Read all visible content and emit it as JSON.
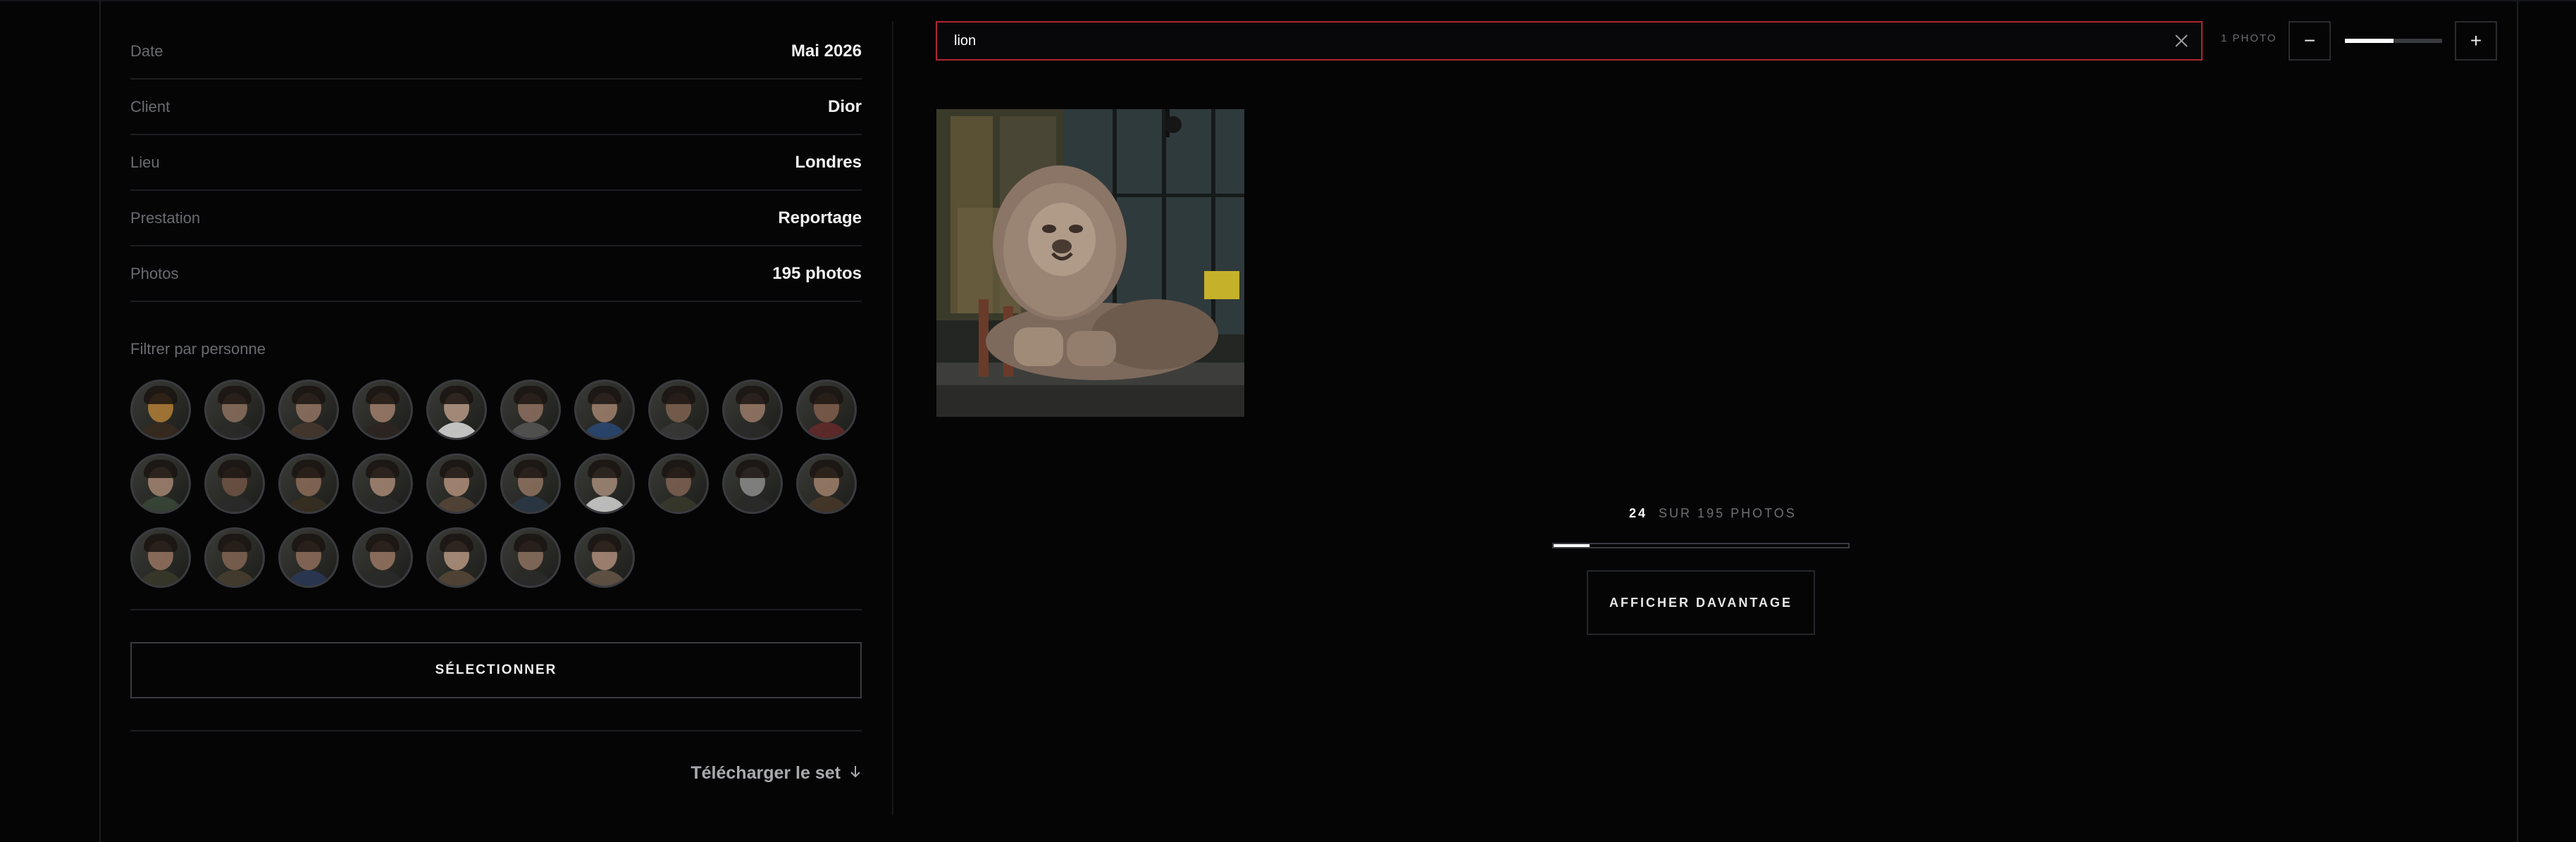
{
  "details": [
    {
      "label": "Date",
      "value": "Mai 2026"
    },
    {
      "label": "Client",
      "value": "Dior"
    },
    {
      "label": "Lieu",
      "value": "Londres"
    },
    {
      "label": "Prestation",
      "value": "Reportage"
    },
    {
      "label": "Photos",
      "value": "195 photos"
    }
  ],
  "filter": {
    "title": "Filtrer par personne",
    "people_count": 27
  },
  "select_label": "SÉLECTIONNER",
  "download_label": "Télécharger le set",
  "search": {
    "value": "lion",
    "result_count": "1 PHOTO"
  },
  "zoom": {
    "minus": "−",
    "plus": "+",
    "level_fraction": 0.5
  },
  "pagination": {
    "shown": "24",
    "rest": "SUR 195 PHOTOS",
    "progress_fraction": 0.123
  },
  "load_more_label": "AFFICHER DAVANTAGE",
  "colors": {
    "accent_border": "#b1262f",
    "background": "#050506"
  },
  "icons": {
    "clear": "close-icon",
    "download": "arrow-down-icon"
  }
}
